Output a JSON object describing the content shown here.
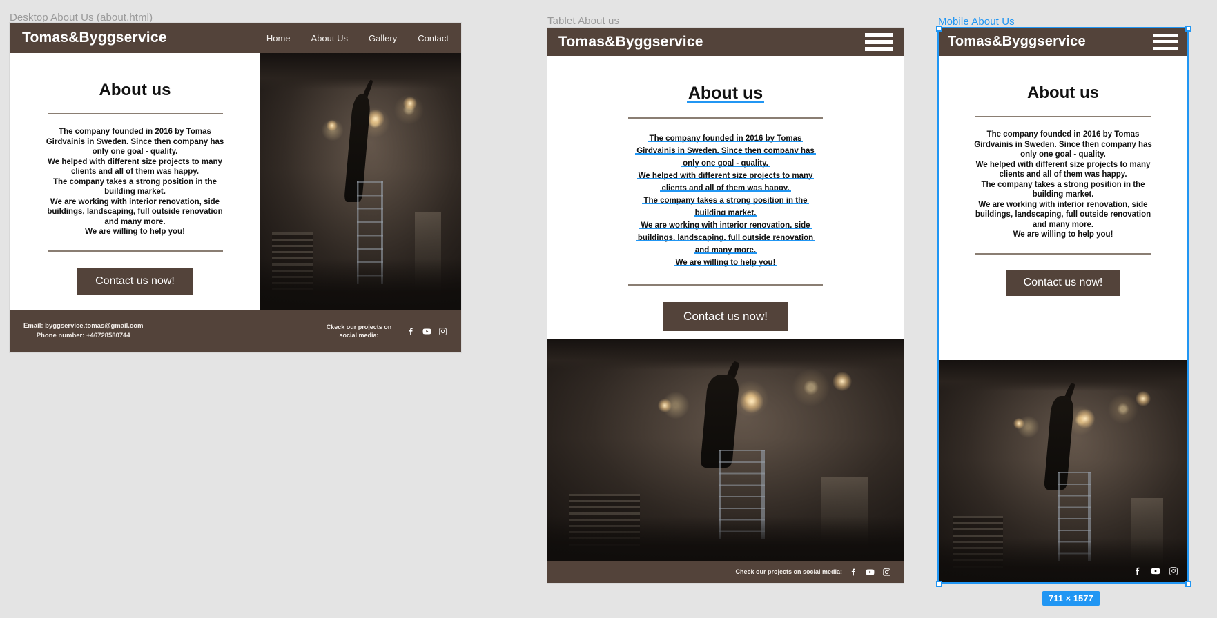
{
  "brand": "Tomas&Byggservice",
  "nav": [
    {
      "label": "Home"
    },
    {
      "label": "About Us"
    },
    {
      "label": "Gallery"
    },
    {
      "label": "Contact"
    }
  ],
  "heading": "About us",
  "paragraph_lines": [
    "The company founded in 2016 by Tomas",
    "Girdvainis in Sweden. Since then company has",
    "only one goal - quality.",
    "We helped with different size projects to many",
    "clients and all of them was happy.",
    "The company takes a strong position in the",
    "building market.",
    "We are working with interior renovation, side",
    "buildings, landscaping, full outside renovation",
    "and many more.",
    "We are willing to help you!"
  ],
  "tablet_paragraph_lines": [
    "The company founded in 2016 by Tomas",
    "Girdvainis in Sweden. Since then company has",
    "only one goal - quality.",
    "We helped with different size projects to many",
    "clients and all of them was happy.",
    "The company takes a strong position in the",
    "building market.",
    "We are working with interior renovation, side",
    "buildings, landscaping, full outside renovation",
    "and many more.",
    "We are willing to help you!"
  ],
  "cta_label": "Contact us now!",
  "footer": {
    "email": "Email: byggservice.tomas@gmail.com",
    "phone": "Phone number: +46728580744",
    "social_prompt_desktop": "Ckeck our projects on social media:",
    "social_prompt_tablet": "Check our projects on social media:",
    "icons": [
      "facebook-icon",
      "youtube-icon",
      "instagram-icon"
    ]
  },
  "frames": {
    "desktop": {
      "label": "Desktop  About Us (about.html)"
    },
    "tablet": {
      "label": "Tablet About us"
    },
    "mobile": {
      "label": "Mobile About Us",
      "size_badge": "711 × 1577"
    }
  },
  "colors": {
    "brand_brown": "#53433a",
    "canvas": "#e4e4e4",
    "selection_blue": "#2196f3",
    "rule": "#8a7e73"
  }
}
